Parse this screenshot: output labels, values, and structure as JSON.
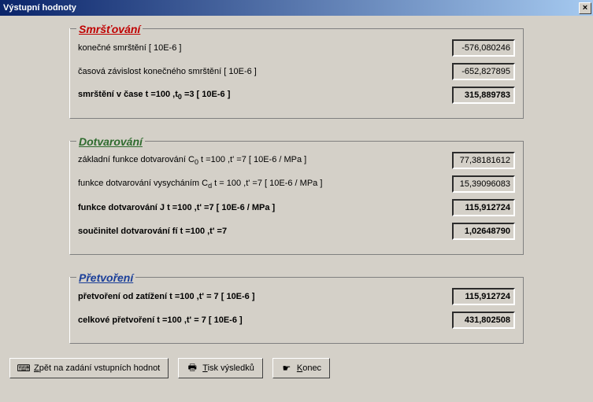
{
  "window": {
    "title": "Výstupní hodnoty"
  },
  "smrstovani": {
    "legend": "Smršťování",
    "row1": {
      "label": "konečné smrštění [ 10E-6 ]",
      "value": "-576,080246"
    },
    "row2": {
      "label": "časová závislost konečného smrštění [ 10E-6 ]",
      "value": "-652,827895"
    },
    "row3": {
      "label_html": "smrštění v čase t =100    ,t<sub>0</sub> =3      [ 10E-6 ]",
      "value": "315,889783"
    }
  },
  "dotvarovani": {
    "legend": "Dotvarování",
    "row1": {
      "label_html": "základní funkce dotvarování C<sub>0</sub> t =100      ,t' =7      [ 10E-6 / MPa ]",
      "value": "77,38181612"
    },
    "row2": {
      "label_html": "funkce dotvarování vysycháním C<sub>d</sub> t = 100     ,t' =7     [ 10E-6 / MPa ]",
      "value": "15,39096083"
    },
    "row3": {
      "label": "funkce dotvarování J t =100    ,t' =7       [ 10E-6 / MPa ]",
      "value": "115,912724"
    },
    "row4": {
      "label": "součinitel dotvarování fí   t  =100    ,t' =7",
      "value": "1,02648790"
    }
  },
  "pretvoreni": {
    "legend": "Přetvoření",
    "row1": {
      "label": "přetvoření od zatížení t =100    ,t'  = 7      [ 10E-6 ]",
      "value": "115,912724"
    },
    "row2": {
      "label": "celkové přetvoření t =100    ,t'  = 7      [ 10E-6 ]",
      "value": "431,802508"
    }
  },
  "buttons": {
    "back": "Zpět na zadání vstupních hodnot",
    "print": "Tisk výsledků",
    "end": "Konec"
  }
}
